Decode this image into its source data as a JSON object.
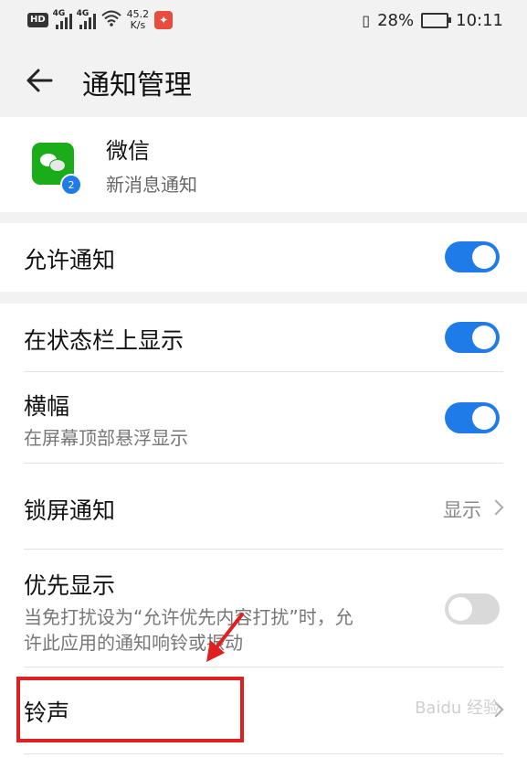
{
  "status": {
    "network_a": "4G",
    "network_b": "4G",
    "speed": "45.2",
    "speed_unit": "K/s",
    "battery": "28%",
    "time": "10:11"
  },
  "toolbar": {
    "title": "通知管理"
  },
  "app": {
    "name": "微信",
    "subtitle": "新消息通知",
    "twin_badge": "2"
  },
  "settings": {
    "allow_notifications": {
      "label": "允许通知",
      "state": "on"
    },
    "status_bar": {
      "label": "在状态栏上显示",
      "state": "on"
    },
    "banner": {
      "label": "横幅",
      "sub": "在屏幕顶部悬浮显示",
      "state": "on"
    },
    "lock_screen": {
      "label": "锁屏通知",
      "value": "显示"
    },
    "priority": {
      "label": "优先显示",
      "sub_line1": "当免打扰设为“允许优先内容打扰”时，允",
      "sub_line2": "许此应用的通知响铃或振动",
      "state": "off"
    },
    "ringtone": {
      "label": "铃声"
    }
  },
  "watermark": "Baidu 经验",
  "colors": {
    "accent": "#1e7be8",
    "highlight": "#e02020"
  }
}
